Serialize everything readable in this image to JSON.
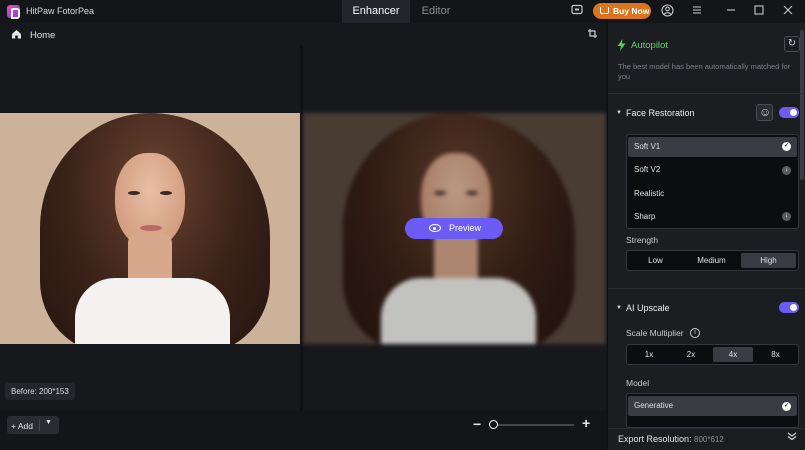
{
  "titlebar": {
    "app_name": "HitPaw FotorPea",
    "tabs": [
      "Enhancer",
      "Editor"
    ],
    "buy_now": "Buy Now",
    "icons": [
      "screen-icon",
      "cart-icon",
      "account-icon",
      "menu-icon",
      "minimize-icon",
      "maximize-icon",
      "close-icon"
    ]
  },
  "toolbar": {
    "home_label": "Home"
  },
  "canvas": {
    "preview_label": "Preview",
    "size_badge": "Before: 200*153"
  },
  "bottombar": {
    "add_label": "Add"
  },
  "sidebar": {
    "autopilot": {
      "title": "Autopilot",
      "description": "The best model has been automatically matched for you"
    },
    "face_restoration": {
      "title": "Face Restoration",
      "enabled": true,
      "models": [
        {
          "label": "Soft V1",
          "selected": true
        },
        {
          "label": "Soft V2",
          "selected": false
        },
        {
          "label": "Realistic",
          "selected": false
        },
        {
          "label": "Sharp",
          "selected": false
        }
      ],
      "strength_label": "Strength",
      "strength_options": [
        "Low",
        "Medium",
        "High"
      ],
      "strength_selected": "High"
    },
    "ai_upscale": {
      "title": "AI Upscale",
      "enabled": true,
      "scale_label": "Scale Multiplier",
      "scale_options": [
        "1x",
        "2x",
        "4x",
        "8x"
      ],
      "scale_selected": "4x",
      "model_label": "Model",
      "model_selected": "Generative"
    },
    "export": {
      "label": "Export Resolution:",
      "value": "800*612"
    }
  },
  "colors": {
    "accent": "#6b5cf6",
    "buy_now": "#d9741f",
    "autopilot": "#5fd75f"
  }
}
